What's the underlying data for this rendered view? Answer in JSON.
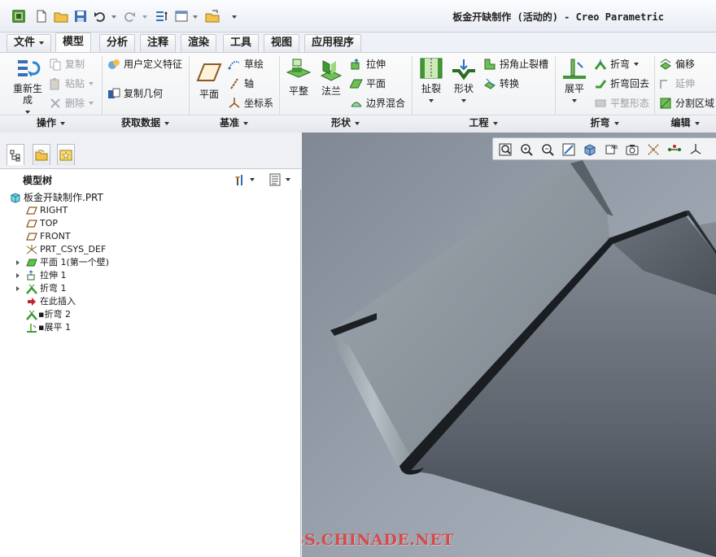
{
  "window": {
    "title": "板金开缺制作 (活动的) - Creo Parametric"
  },
  "tabs": [
    {
      "label": "文件",
      "has_dropdown": true
    },
    {
      "label": "模型",
      "active": true
    },
    {
      "label": "分析"
    },
    {
      "label": "注释"
    },
    {
      "label": "渲染"
    },
    {
      "label": "工具"
    },
    {
      "label": "视图"
    },
    {
      "label": "应用程序"
    }
  ],
  "ribbon": {
    "operations": {
      "label": "操作",
      "regenerate": "重新生成",
      "copy": "复制",
      "paste": "粘贴",
      "delete": "删除"
    },
    "get_data": {
      "label": "获取数据",
      "udf": "用户定义特征",
      "copy_geom": "复制几何"
    },
    "datum": {
      "label": "基准",
      "plane": "平面",
      "sketch": "草绘",
      "axis": "轴",
      "csys": "坐标系"
    },
    "shapes": {
      "label": "形状",
      "flat": "平整",
      "flange": "法兰",
      "extrude": "拉伸",
      "plane": "平面",
      "boundary_blend": "边界混合"
    },
    "engineering": {
      "label": "工程",
      "rip": "扯裂",
      "form": "形状",
      "corner_relief": "拐角止裂槽",
      "convert": "转换"
    },
    "bends": {
      "label": "折弯",
      "unbend": "展平",
      "bend": "折弯",
      "bend_back": "折弯回去",
      "flatten_form": "平整形态"
    },
    "editing": {
      "label": "编辑",
      "offset": "偏移",
      "extend": "延伸",
      "split_area": "分割区域"
    }
  },
  "model_tree": {
    "title": "模型树",
    "items": [
      {
        "label": "板金开缺制作.PRT",
        "icon": "part-icon"
      },
      {
        "label": "RIGHT",
        "icon": "datum-plane-icon"
      },
      {
        "label": "TOP",
        "icon": "datum-plane-icon"
      },
      {
        "label": "FRONT",
        "icon": "datum-plane-icon"
      },
      {
        "label": "PRT_CSYS_DEF",
        "icon": "csys-icon"
      },
      {
        "label": "平面 1(第一个壁)",
        "icon": "flat-wall-icon"
      },
      {
        "label": "拉伸 1",
        "icon": "extrude-icon"
      },
      {
        "label": "折弯 1",
        "icon": "bend-icon"
      },
      {
        "label": "在此插入",
        "icon": "insert-here-icon"
      },
      {
        "label": "折弯 2",
        "icon": "bend-icon"
      },
      {
        "label": "展平 1",
        "icon": "unbend-icon"
      }
    ]
  },
  "viewport": {
    "watermark": "BBS.CHINADE.NET"
  }
}
